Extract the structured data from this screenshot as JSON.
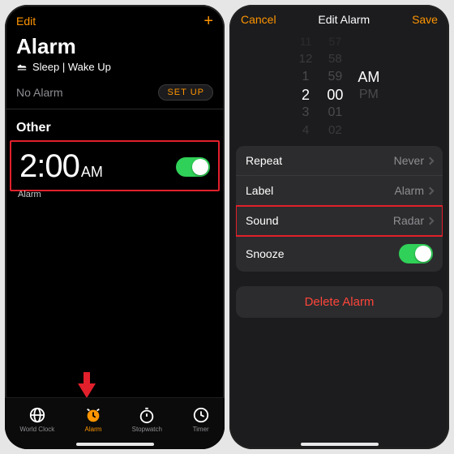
{
  "left": {
    "nav": {
      "edit": "Edit",
      "add": "+"
    },
    "title": "Alarm",
    "sleep_section": "Sleep | Wake Up",
    "no_alarm": "No Alarm",
    "setup": "SET UP",
    "other_header": "Other",
    "alarm": {
      "time": "2:00",
      "ampm": "AM",
      "label": "Alarm",
      "on": true
    },
    "tabs": [
      {
        "id": "worldclock",
        "label": "World Clock"
      },
      {
        "id": "alarm",
        "label": "Alarm"
      },
      {
        "id": "stopwatch",
        "label": "Stopwatch"
      },
      {
        "id": "timer",
        "label": "Timer"
      }
    ],
    "active_tab": "alarm"
  },
  "right": {
    "nav": {
      "cancel": "Cancel",
      "title": "Edit Alarm",
      "save": "Save"
    },
    "picker": {
      "hours": [
        "11",
        "12",
        "1",
        "2",
        "3",
        "4"
      ],
      "minutes": [
        "57",
        "58",
        "59",
        "00",
        "01",
        "02"
      ],
      "period": [
        "",
        "",
        "",
        "AM",
        "PM",
        ""
      ],
      "selected_index": 3
    },
    "settings": {
      "repeat": {
        "label": "Repeat",
        "value": "Never"
      },
      "label": {
        "label": "Label",
        "value": "Alarm"
      },
      "sound": {
        "label": "Sound",
        "value": "Radar"
      },
      "snooze": {
        "label": "Snooze",
        "on": true
      }
    },
    "delete": "Delete Alarm"
  }
}
